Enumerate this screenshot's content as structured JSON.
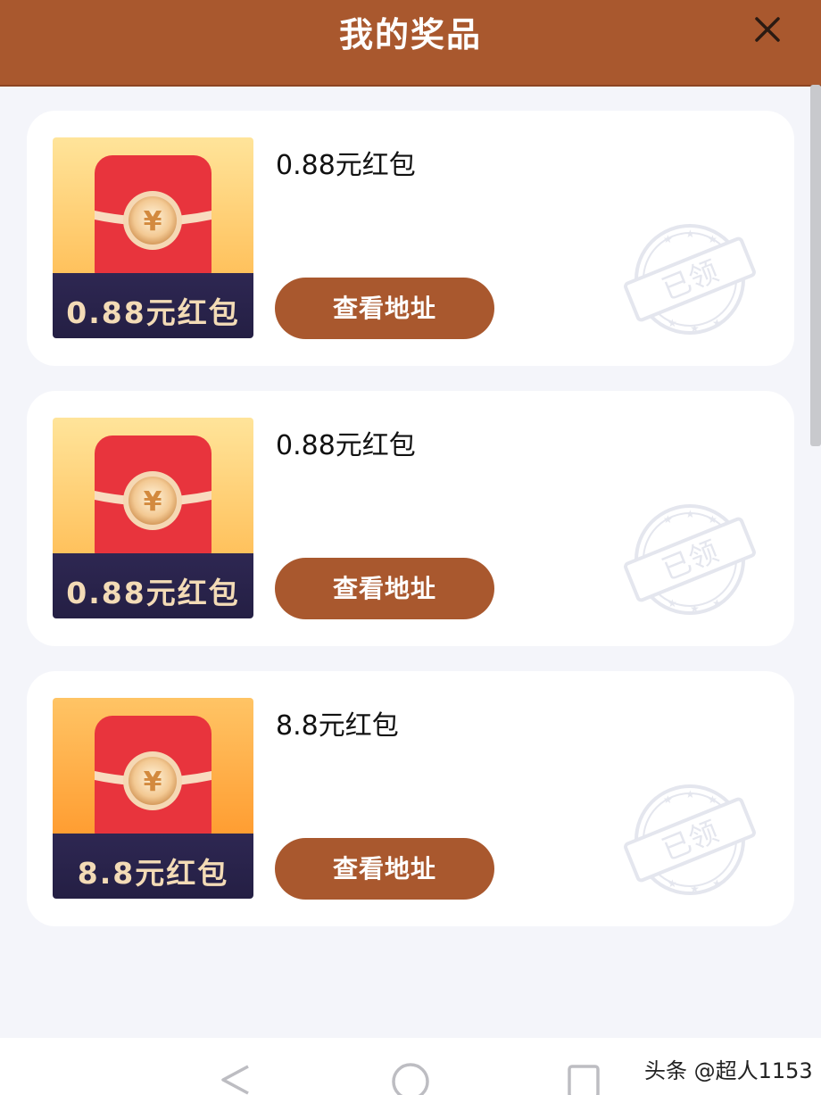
{
  "header": {
    "title": "我的奖品"
  },
  "prizes": [
    {
      "name": "0.88元红包",
      "thumb_label": "0.88元红包",
      "button_label": "查看地址",
      "stamp_text": "已领"
    },
    {
      "name": "0.88元红包",
      "thumb_label": "0.88元红包",
      "button_label": "查看地址",
      "stamp_text": "已领"
    },
    {
      "name": "8.8元红包",
      "thumb_label": "8.8元红包",
      "button_label": "查看地址",
      "stamp_text": "已领"
    }
  ],
  "watermark": "头条 @超人1153",
  "icons": {
    "close": "close-icon",
    "back": "back-triangle-icon",
    "home": "home-circle-icon",
    "recents": "recents-square-icon",
    "envelope": "red-envelope-icon",
    "yuan": "yuan-coin-icon"
  },
  "colors": {
    "header": "#a9582e",
    "button": "#a9582e",
    "envelope": "#e8343d",
    "band": "#2e2752",
    "band_text": "#f3dbb6",
    "page_bg": "#f4f5fa"
  }
}
